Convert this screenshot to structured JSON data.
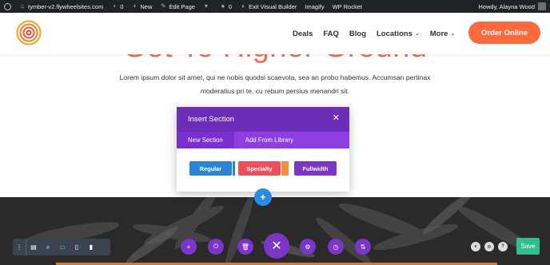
{
  "adminbar": {
    "site": "tymber-v2.flywheelsites.com",
    "comments_count": "0",
    "new_label": "New",
    "edit_page_label": "Edit Page",
    "woo_icon_label": "",
    "vaccount": "0",
    "exit_builder_label": "Exit Visual Builder",
    "imagify_label": "Imagify",
    "rocket_label": "WP Rocket",
    "howdy": "Howdy, Alayna Wood"
  },
  "header": {
    "nav": [
      {
        "label": "Deals"
      },
      {
        "label": "FAQ"
      },
      {
        "label": "Blog"
      },
      {
        "label": "Locations",
        "caret": "⌄"
      },
      {
        "label": "More",
        "caret": "⌄"
      }
    ],
    "cta": "Order Online"
  },
  "hero": {
    "heading": "Get To Higher Ground",
    "paragraph": "Lorem ipsum dolor sit amet, qui ne nobis quodsi scaevola, sea an probo habemus. Accumsan pertinax moderatius pri te, cu rebum persius menandri sit."
  },
  "modal": {
    "title": "Insert Section",
    "close_icon": "close-icon",
    "tabs": [
      "New Section",
      "Add From Library"
    ],
    "buttons": [
      {
        "label": "Regular",
        "color": "#2a85d6"
      },
      {
        "label": "Specialty",
        "color": "#ef4f5d"
      },
      {
        "label": "Fullwidth",
        "color": "#7b35c7"
      }
    ]
  },
  "builder": {
    "save_label": "Save",
    "colors": {
      "purple": "#7b36c8",
      "save": "#2fbf8f",
      "blue": "#2a8ce0",
      "brand": "#ff6a3d"
    }
  }
}
